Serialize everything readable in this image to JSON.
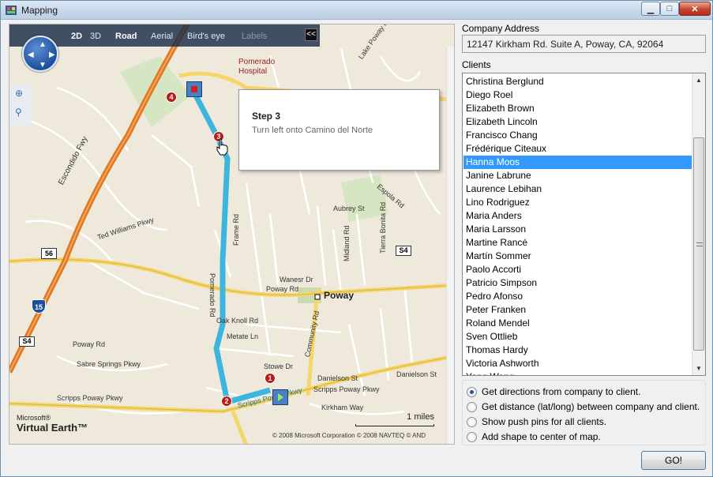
{
  "window": {
    "title": "Mapping",
    "minimize": "▁",
    "maximize": "□",
    "close": "✕"
  },
  "map": {
    "modes": [
      "2D",
      "3D",
      "Road",
      "Aerial",
      "Bird's eye",
      "Labels"
    ],
    "active_mode": "Road",
    "collapse_label": "<<",
    "callout": {
      "title": "Step 3",
      "description": "Turn left onto Camino del Norte"
    },
    "brand_small": "Microsoft®",
    "brand_big": "Virtual Earth™",
    "copyright": "© 2008 Microsoft Corporation     © 2008 NAVTEQ  © AND",
    "scale_label": "1 miles",
    "places": {
      "hospital": "Pomerado Hospital",
      "poway": "Poway",
      "escondido": "Escondido Fwy",
      "scripps": "Scripps Poway Pkwy",
      "pomerado": "Pomerado Rd",
      "poway_rd": "Poway Rd",
      "community": "Community Rd",
      "kirkham": "Kirkham Way",
      "danielson": "Danielson St",
      "midland": "Midland Rd",
      "sabre": "Sabre Springs Pkwy",
      "ted": "Ted Williams Pkwy",
      "espola": "Espola Rd",
      "hw56": "56",
      "hw15": "15",
      "s4a": "S4",
      "s4b": "S4",
      "lake": "Lake Poway Rd",
      "aubrey": "Aubrey St",
      "stowe": "Stowe Dr",
      "metate": "Metate Ln",
      "oak": "Oak Knoll Rd",
      "wanesr": "Wanesr Dr",
      "tierra": "Tierra Bonita Rd",
      "frame": "Frame Rd",
      "camino": "Camino del Norte"
    },
    "markers": [
      "1",
      "2",
      "3",
      "4"
    ]
  },
  "right": {
    "address_label": "Company Address",
    "address_value": "12147 Kirkham Rd. Suite A, Poway, CA, 92064",
    "clients_label": "Clients",
    "clients": [
      "Christina Berglund",
      "Diego Roel",
      "Elizabeth Brown",
      "Elizabeth Lincoln",
      "Francisco Chang",
      "Frédérique Citeaux",
      "Hanna Moos",
      "Janine Labrune",
      "Laurence Lebihan",
      "Lino Rodriguez",
      "Maria Anders",
      "Maria Larsson",
      "Martine Rancé",
      "Martín Sommer",
      "Paolo Accorti",
      "Patricio Simpson",
      "Pedro Afonso",
      "Peter Franken",
      "Roland Mendel",
      "Sven Ottlieb",
      "Thomas Hardy",
      "Victoria Ashworth",
      "Yang Wang"
    ],
    "selected_client": "Hanna Moos",
    "options": [
      "Get directions from company to client.",
      "Get distance (lat/long) between company and client.",
      "Show push pins for all clients.",
      "Add shape to center of map."
    ],
    "selected_option": "Get directions from company to client.",
    "go_label": "GO!"
  },
  "colors": {
    "route": "#3cb6dd",
    "freeway": "#e0781e",
    "arterial": "#f6d56a",
    "selection": "#3399ff",
    "marker": "#b91c1c"
  }
}
